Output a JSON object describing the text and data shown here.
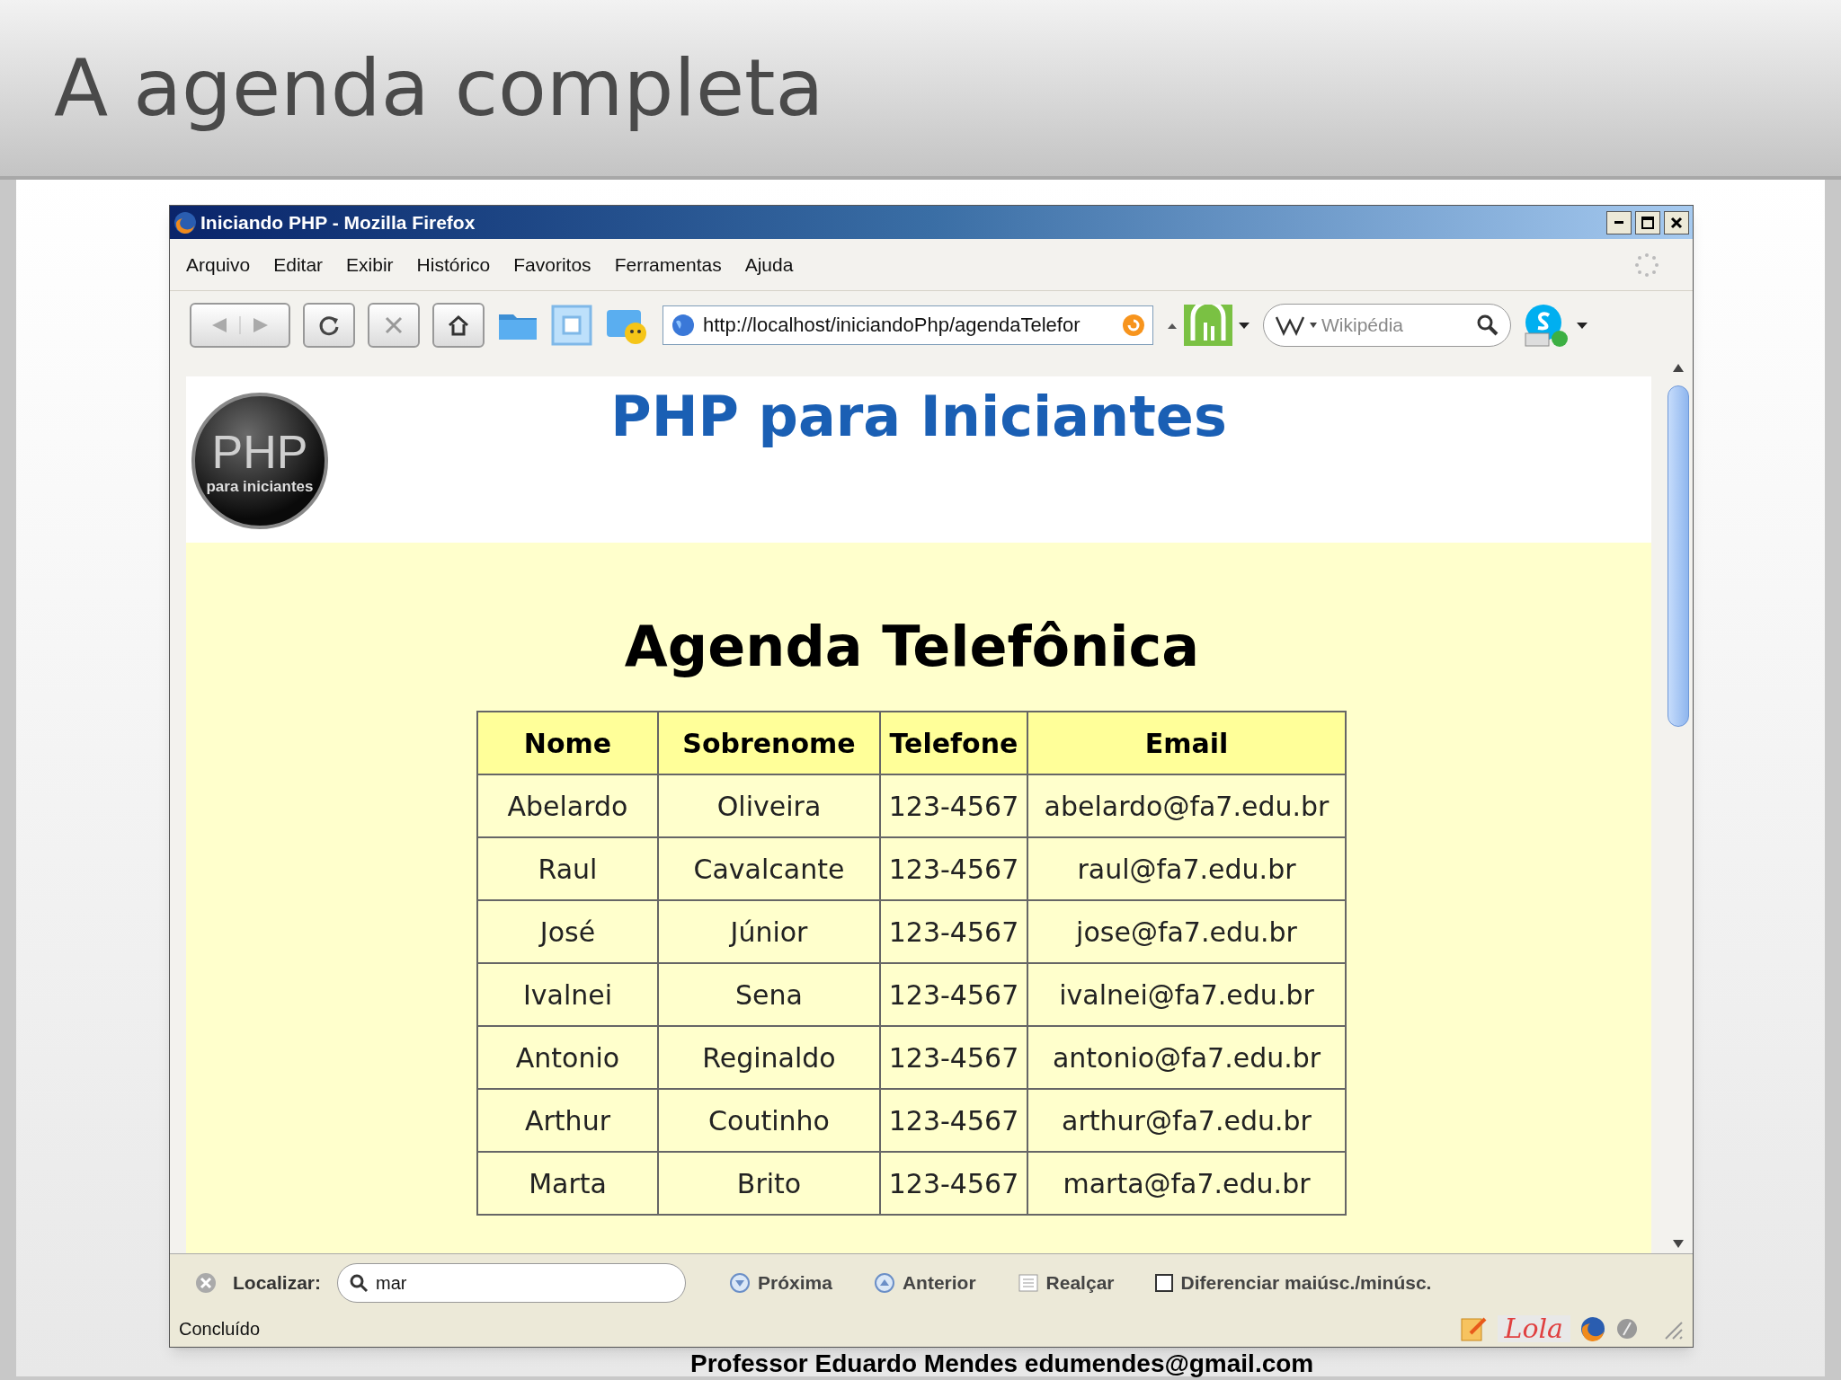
{
  "slide": {
    "title": "A agenda completa",
    "footer": "Professor Eduardo Mendes edumendes@gmail.com"
  },
  "window": {
    "title": "Iniciando PHP - Mozilla Firefox",
    "menu": [
      "Arquivo",
      "Editar",
      "Exibir",
      "Histórico",
      "Favoritos",
      "Ferramentas",
      "Ajuda"
    ],
    "toolbar": {
      "url": "http://localhost/iniciandoPhp/agendaTelefor",
      "search_placeholder": "Wikipédia"
    },
    "page": {
      "logo": {
        "title": "PHP",
        "subtitle": "para iniciantes"
      },
      "heading": "PHP para Iniciantes",
      "table_title": "Agenda Telefônica",
      "table": {
        "columns": [
          "Nome",
          "Sobrenome",
          "Telefone",
          "Email"
        ],
        "rows": [
          [
            "Abelardo",
            "Oliveira",
            "123-4567",
            "abelardo@fa7.edu.br"
          ],
          [
            "Raul",
            "Cavalcante",
            "123-4567",
            "raul@fa7.edu.br"
          ],
          [
            "José",
            "Júnior",
            "123-4567",
            "jose@fa7.edu.br"
          ],
          [
            "Ivalnei",
            "Sena",
            "123-4567",
            "ivalnei@fa7.edu.br"
          ],
          [
            "Antonio",
            "Reginaldo",
            "123-4567",
            "antonio@fa7.edu.br"
          ],
          [
            "Arthur",
            "Coutinho",
            "123-4567",
            "arthur@fa7.edu.br"
          ],
          [
            "Marta",
            "Brito",
            "123-4567",
            "marta@fa7.edu.br"
          ]
        ]
      }
    },
    "find_bar": {
      "label": "Localizar:",
      "query": "mar",
      "buttons": [
        {
          "kind": "down",
          "label": "Próxima"
        },
        {
          "kind": "up",
          "label": "Anterior"
        },
        {
          "kind": "highlight",
          "label": "Realçar"
        }
      ],
      "match_case": {
        "label": "Diferenciar maiúsc./minúsc.",
        "checked": false
      }
    },
    "status_bar": {
      "text": "Concluído",
      "badge": "Lola"
    }
  }
}
